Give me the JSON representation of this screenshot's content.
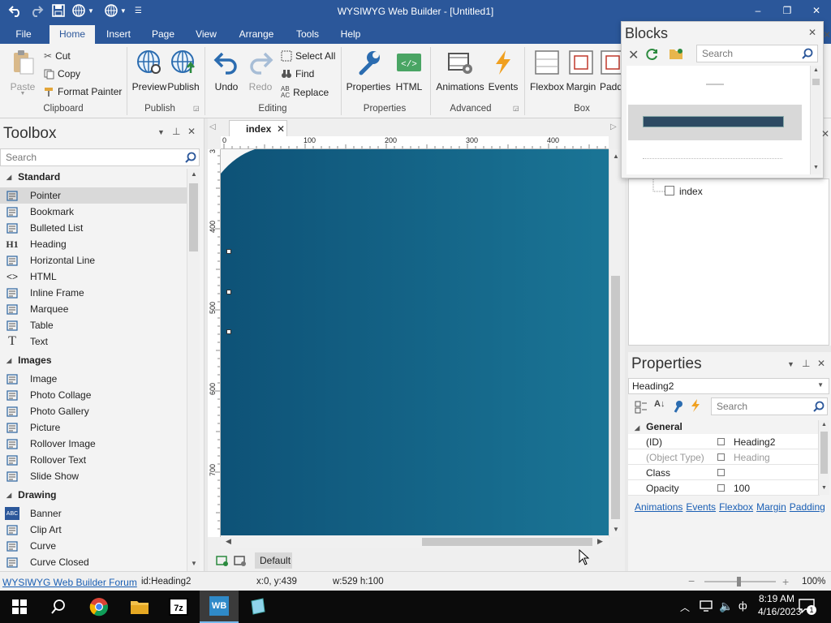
{
  "window": {
    "title": "WYSIWYG Web Builder - [Untitled1]",
    "controls": {
      "minimize": "–",
      "restore": "❐",
      "close": "✕"
    }
  },
  "ribbon": {
    "tabs": [
      "File",
      "Home",
      "Insert",
      "Page",
      "View",
      "Arrange",
      "Tools",
      "Help"
    ],
    "active_tab": "Home",
    "clipboard": {
      "paste": "Paste",
      "cut": "Cut",
      "copy": "Copy",
      "format_painter": "Format Painter",
      "group": "Clipboard"
    },
    "publish": {
      "preview": "Preview",
      "publish": "Publish",
      "group": "Publish"
    },
    "editing": {
      "undo": "Undo",
      "redo": "Redo",
      "select_all": "Select All",
      "find": "Find",
      "replace": "Replace",
      "group": "Editing"
    },
    "properties": {
      "properties": "Properties",
      "html": "HTML",
      "group": "Properties"
    },
    "advanced": {
      "animations": "Animations",
      "events": "Events",
      "group": "Advanced"
    },
    "box": {
      "flexbox": "Flexbox",
      "margin": "Margin",
      "padding": "Padd",
      "group": "Box"
    }
  },
  "toolbox": {
    "title": "Toolbox",
    "search_placeholder": "Search",
    "categories": [
      {
        "name": "Standard",
        "items": [
          {
            "label": "Pointer",
            "icon": "pointer-icon",
            "selected": true
          },
          {
            "label": "Bookmark",
            "icon": "anchor-icon"
          },
          {
            "label": "Bulleted List",
            "icon": "list-icon"
          },
          {
            "label": "Heading",
            "icon": "heading-icon",
            "glyph": "H1"
          },
          {
            "label": "Horizontal Line",
            "icon": "hline-icon"
          },
          {
            "label": "HTML",
            "icon": "code-icon",
            "glyph": "<>"
          },
          {
            "label": "Inline Frame",
            "icon": "iframe-icon"
          },
          {
            "label": "Marquee",
            "icon": "marquee-icon"
          },
          {
            "label": "Table",
            "icon": "table-icon"
          },
          {
            "label": "Text",
            "icon": "text-icon",
            "glyph": "T"
          }
        ]
      },
      {
        "name": "Images",
        "items": [
          {
            "label": "Image",
            "icon": "image-icon"
          },
          {
            "label": "Photo Collage",
            "icon": "collage-icon"
          },
          {
            "label": "Photo Gallery",
            "icon": "gallery-icon"
          },
          {
            "label": "Picture",
            "icon": "picture-icon"
          },
          {
            "label": "Rollover Image",
            "icon": "rollover-image-icon"
          },
          {
            "label": "Rollover Text",
            "icon": "rollover-text-icon"
          },
          {
            "label": "Slide Show",
            "icon": "slideshow-icon"
          }
        ]
      },
      {
        "name": "Drawing",
        "items": [
          {
            "label": "Banner",
            "icon": "banner-icon",
            "glyph": "ABC"
          },
          {
            "label": "Clip Art",
            "icon": "clipart-icon"
          },
          {
            "label": "Curve",
            "icon": "curve-icon"
          },
          {
            "label": "Curve Closed",
            "icon": "curve-closed-icon"
          }
        ]
      }
    ]
  },
  "editor": {
    "tab": "index",
    "ruler_top": [
      "0",
      "100",
      "200",
      "300",
      "400"
    ],
    "ruler_left": [
      "3",
      "400",
      "500",
      "600",
      "700"
    ],
    "canvas_gradient": [
      "#0e5277",
      "#1a7596"
    ],
    "mode_label": "Default"
  },
  "blocks": {
    "title": "Blocks",
    "search_placeholder": "Search"
  },
  "site_tree": {
    "page": "index"
  },
  "properties": {
    "title": "Properties",
    "selected_object": "Heading2",
    "search_placeholder": "Search",
    "section": "General",
    "rows": [
      {
        "name": "(ID)",
        "value": "Heading2",
        "dim": false
      },
      {
        "name": "(Object Type)",
        "value": "Heading",
        "dim": true
      },
      {
        "name": "Class",
        "value": "",
        "dim": false
      },
      {
        "name": "Opacity",
        "value": "100",
        "dim": false
      }
    ],
    "links": [
      "Animations",
      "Events",
      "Flexbox",
      "Margin",
      "Padding"
    ]
  },
  "status": {
    "forum_link": "WYSIWYG Web Builder Forum",
    "id": "id:Heading2",
    "position": "x:0, y:439",
    "size": "w:529 h:100",
    "zoom": "100%"
  },
  "taskbar": {
    "time": "8:19 AM",
    "date": "4/16/2023",
    "notifications": "1",
    "apps": [
      "start",
      "search",
      "chrome",
      "file-explorer",
      "7zip",
      "wysiwyg-web-builder",
      "notepad"
    ]
  }
}
